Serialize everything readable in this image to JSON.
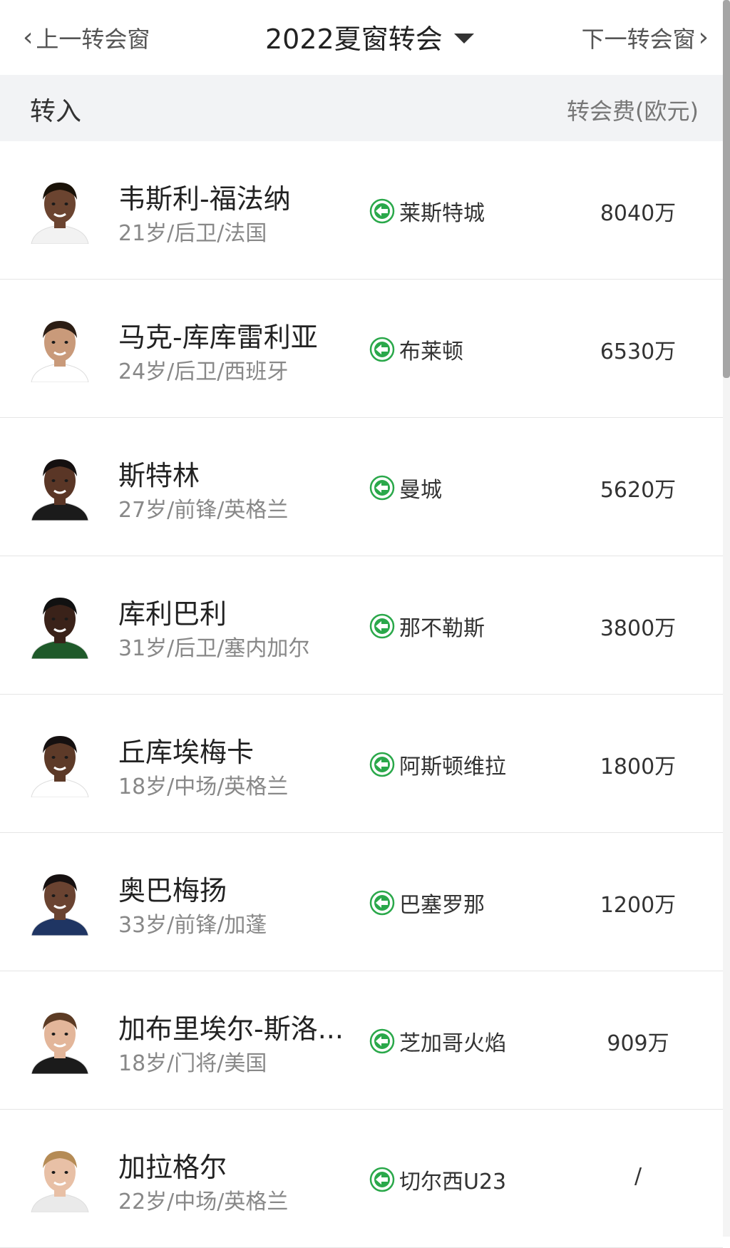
{
  "nav": {
    "prev_label": "上一转会窗",
    "next_label": "下一转会窗",
    "window_title": "2022夏窗转会"
  },
  "section": {
    "title": "转入",
    "fee_header": "转会费(欧元)"
  },
  "colors": {
    "arrow_green": "#2aa84a",
    "header_bg": "#f2f3f5"
  },
  "players": [
    {
      "name": "韦斯利-福法纳",
      "meta": "21岁/后卫/法国",
      "from": "莱斯特城",
      "fee": "8040万",
      "skin": "#6b4430",
      "hair": "#1a1208",
      "shirt": "#f2f2f2"
    },
    {
      "name": "马克-库库雷利亚",
      "meta": "24岁/后卫/西班牙",
      "from": "布莱顿",
      "fee": "6530万",
      "skin": "#c99a7a",
      "hair": "#2b1d14",
      "shirt": "#ffffff"
    },
    {
      "name": "斯特林",
      "meta": "27岁/前锋/英格兰",
      "from": "曼城",
      "fee": "5620万",
      "skin": "#5a3626",
      "hair": "#141010",
      "shirt": "#1b1b1b"
    },
    {
      "name": "库利巴利",
      "meta": "31岁/后卫/塞内加尔",
      "from": "那不勒斯",
      "fee": "3800万",
      "skin": "#3a2219",
      "hair": "#111",
      "shirt": "#1f5a2a"
    },
    {
      "name": "丘库埃梅卡",
      "meta": "18岁/中场/英格兰",
      "from": "阿斯顿维拉",
      "fee": "1800万",
      "skin": "#5d3a28",
      "hair": "#151010",
      "shirt": "#ffffff"
    },
    {
      "name": "奥巴梅扬",
      "meta": "33岁/前锋/加蓬",
      "from": "巴塞罗那",
      "fee": "1200万",
      "skin": "#6a4331",
      "hair": "#161010",
      "shirt": "#1f3563"
    },
    {
      "name": "加布里埃尔-斯洛...",
      "meta": "18岁/门将/美国",
      "from": "芝加哥火焰",
      "fee": "909万",
      "skin": "#e3b69a",
      "hair": "#5c3b24",
      "shirt": "#1b1b1b"
    },
    {
      "name": "加拉格尔",
      "meta": "22岁/中场/英格兰",
      "from": "切尔西U23",
      "fee": "/",
      "skin": "#e8c0a6",
      "hair": "#b58b55",
      "shirt": "#eaeaea"
    }
  ]
}
